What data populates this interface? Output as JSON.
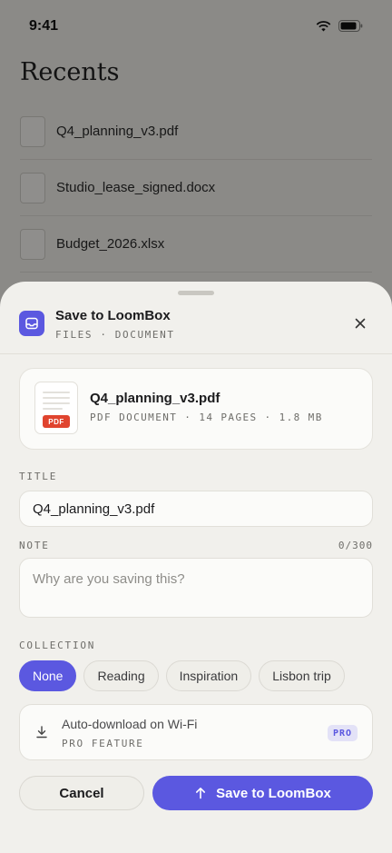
{
  "status_bar": {
    "time": "9:41"
  },
  "background": {
    "title": "Recents",
    "files": [
      {
        "name": "Q4_planning_v3.pdf"
      },
      {
        "name": "Studio_lease_signed.docx"
      },
      {
        "name": "Budget_2026.xlsx"
      }
    ]
  },
  "sheet": {
    "header": {
      "title": "Save to LoomBox",
      "subtitle": "FILES · DOCUMENT"
    },
    "file": {
      "name": "Q4_planning_v3.pdf",
      "badge": "PDF",
      "meta": "PDF DOCUMENT · 14 PAGES · 1.8 MB"
    },
    "title_field": {
      "label": "TITLE",
      "value": "Q4_planning_v3.pdf"
    },
    "note_field": {
      "label": "NOTE",
      "counter": "0/300",
      "placeholder": "Why are you saving this?"
    },
    "collection": {
      "label": "COLLECTION",
      "options": [
        "None",
        "Reading",
        "Inspiration",
        "Lisbon trip"
      ],
      "selected": "None"
    },
    "auto_download": {
      "title": "Auto-download on Wi-Fi",
      "subtitle": "PRO FEATURE",
      "badge": "PRO"
    },
    "buttons": {
      "cancel": "Cancel",
      "save": "Save to LoomBox"
    }
  },
  "colors": {
    "accent": "#5b58e0",
    "pdf_badge": "#e0442f",
    "sheet_bg": "#f1f0ec"
  }
}
